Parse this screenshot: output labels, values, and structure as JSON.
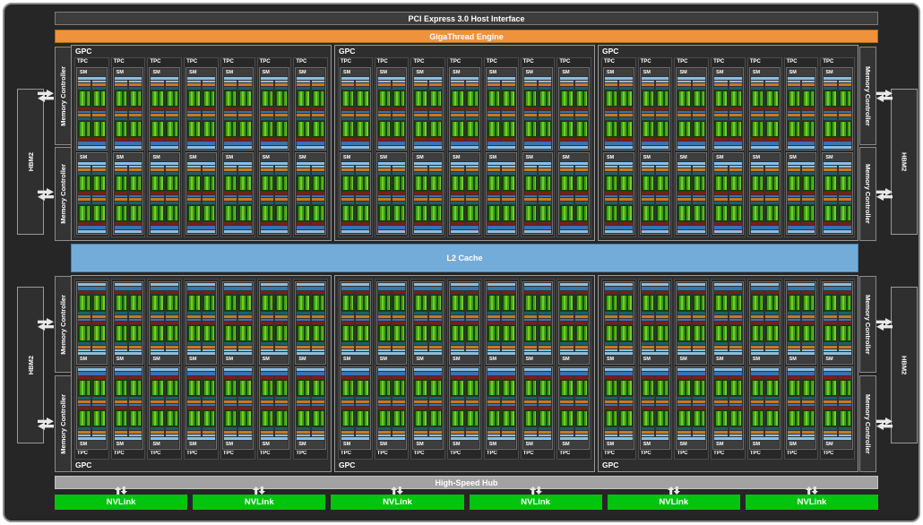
{
  "top": {
    "pci_label": "PCI Express 3.0 Host Interface",
    "gigathread_label": "GigaThread Engine"
  },
  "chip": {
    "gpc_label": "GPC",
    "tpc_label": "TPC",
    "sm_label": "SM",
    "gpc_rows": 2,
    "gpcs_per_row": 3,
    "tpcs_per_gpc": 7,
    "sms_per_tpc": 2
  },
  "center": {
    "l2_label": "L2 Cache"
  },
  "bottom": {
    "hub_label": "High-Speed Hub",
    "nvlink_label": "NVLink",
    "nvlink_count": 6
  },
  "memory": {
    "hbm2_label": "HBM2",
    "mc_label": "Memory Controller",
    "hbm2_per_side": 2,
    "mcs_per_side": 4
  },
  "colors": {
    "frame_bg": "#262626",
    "gigathread_orange": "#f0923c",
    "l2_blue": "#73acd9",
    "nvlink_green": "#01c40e",
    "hub_gray": "#a2a2a2",
    "core_green": "#3fa013",
    "register_orange": "#c8791f",
    "scheduler_lightblue": "#8cbede",
    "sfu_red": "#7c1e14",
    "teal": "#1e5e68"
  }
}
